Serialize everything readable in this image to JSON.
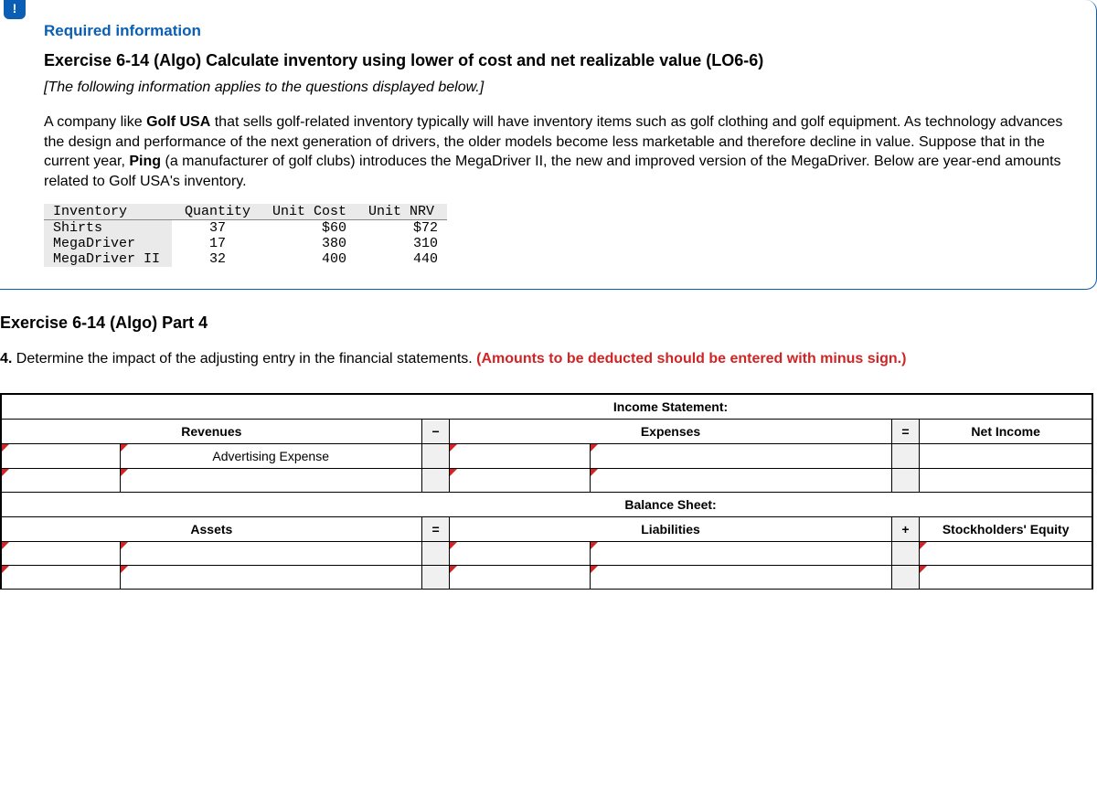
{
  "badge": "!",
  "requiredInfoLabel": "Required information",
  "exerciseTitle": "Exercise 6-14 (Algo) Calculate inventory using lower of cost and net realizable value (LO6-6)",
  "italicNote": "[The following information applies to the questions displayed below.]",
  "bodyText": "A company like Golf USA that sells golf-related inventory typically will have inventory items such as golf clothing and golf equipment. As technology advances the design and performance of the next generation of drivers, the older models become less marketable and therefore decline in value. Suppose that in the current year, Ping (a manufacturer of golf clubs) introduces the MegaDriver II, the new and improved version of the MegaDriver. Below are year-end amounts related to Golf USA's inventory.",
  "inventoryTable": {
    "headers": [
      "Inventory",
      "Quantity",
      "Unit Cost",
      "Unit NRV"
    ],
    "rows": [
      {
        "name": "Shirts",
        "qty": "37",
        "cost": "$60",
        "nrv": "$72"
      },
      {
        "name": "MegaDriver",
        "qty": "17",
        "cost": "380",
        "nrv": "310"
      },
      {
        "name": "MegaDriver II",
        "qty": "32",
        "cost": "400",
        "nrv": "440"
      }
    ]
  },
  "partTitle": "Exercise 6-14 (Algo) Part 4",
  "question": {
    "number": "4.",
    "text": "Determine the impact of the adjusting entry in the financial statements. ",
    "red": "(Amounts to be deducted should be entered with minus sign.)"
  },
  "answer": {
    "incomeStatementLabel": "Income Statement:",
    "balanceSheetLabel": "Balance Sheet:",
    "revenuesLabel": "Revenues",
    "expensesLabel": "Expenses",
    "netIncomeLabel": "Net Income",
    "assetsLabel": "Assets",
    "liabilitiesLabel": "Liabilities",
    "equityLabel": "Stockholders' Equity",
    "minus": "−",
    "equals": "=",
    "plus": "+",
    "row1Selected": "Advertising Expense"
  }
}
